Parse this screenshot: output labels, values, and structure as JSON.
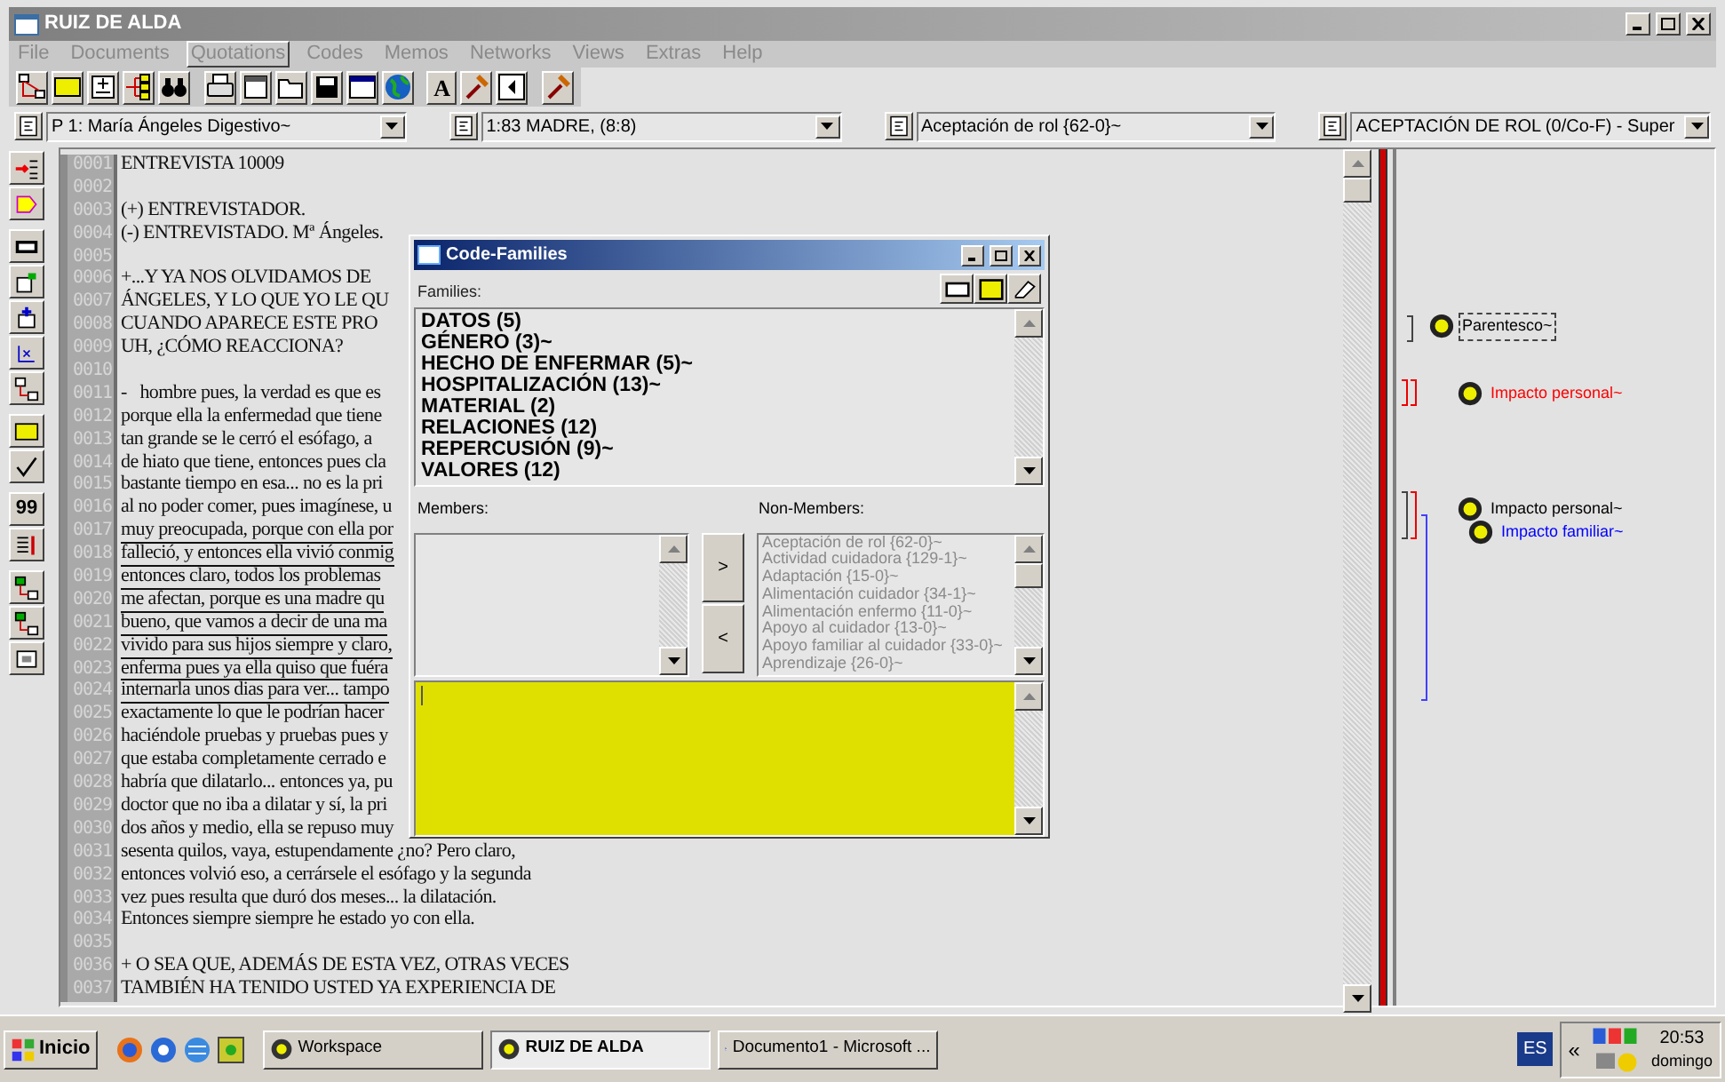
{
  "window": {
    "title": "RUIZ DE ALDA"
  },
  "menu": [
    {
      "label": "File",
      "selected": false
    },
    {
      "label": "Documents",
      "selected": false
    },
    {
      "label": "Quotations",
      "selected": true
    },
    {
      "label": "Codes",
      "selected": false
    },
    {
      "label": "Memos",
      "selected": false
    },
    {
      "label": "Networks",
      "selected": false
    },
    {
      "label": "Views",
      "selected": false
    },
    {
      "label": "Extras",
      "selected": false
    },
    {
      "label": "Help",
      "selected": false
    }
  ],
  "toolbar": {
    "letter_button": "A"
  },
  "selectors": [
    "P 1: María Ángeles Digestivo~",
    "1:83 MADRE, (8:8)",
    "Aceptación de rol {62-0}~",
    "ACEPTACIÓN DE ROL (0/Co-F) - Super"
  ],
  "side_toolbar": {
    "quote_button": "99"
  },
  "document_lines": [
    {
      "number": "0001",
      "text": "ENTREVISTA 10009",
      "underlined": false
    },
    {
      "number": "0002"
    },
    {
      "number": "0003",
      "text": "(+) ENTREVISTADOR.",
      "underlined": false
    },
    {
      "number": "0004",
      "text": "(-) ENTREVISTADO. Mª Ángeles.",
      "underlined": false
    },
    {
      "number": "0005"
    },
    {
      "number": "0006",
      "text": "+...Y YA NOS OLVIDAMOS DE",
      "underlined": false
    },
    {
      "number": "0007",
      "text": "ÁNGELES, Y LO QUE YO LE QU",
      "underlined": false
    },
    {
      "number": "0008",
      "text": "CUANDO APARECE ESTE PRO",
      "underlined": false
    },
    {
      "number": "0009",
      "text": "UH, ¿CÓMO REACCIONA?",
      "underlined": false
    },
    {
      "number": "0010"
    },
    {
      "number": "0011",
      "text": "-   hombre pues, la verdad es que es",
      "underlined": false
    },
    {
      "number": "0012",
      "text": "porque ella la enfermedad que tiene",
      "underlined": false
    },
    {
      "number": "0013",
      "text": "tan grande se le cerró el esófago, a",
      "underlined": false
    },
    {
      "number": "0014",
      "text": "de hiato que tiene, entonces pues cla",
      "underlined": false
    },
    {
      "number": "0015",
      "text": "bastante tiempo en esa... no es la pri",
      "underlined": false
    },
    {
      "number": "0016",
      "text": "al no poder comer, pues imagínese, u",
      "underlined": false
    },
    {
      "number": "0017",
      "text": "muy preocupada, porque con ella por",
      "underlined": true
    },
    {
      "number": "0018",
      "text": "falleció, y entonces ella vivió conmig",
      "underlined": true
    },
    {
      "number": "0019",
      "text": "entonces claro, todos los problemas",
      "underlined": true
    },
    {
      "number": "0020",
      "text": "me afectan, porque es una madre qu",
      "underlined": true
    },
    {
      "number": "0021",
      "text": "bueno, que vamos a decir de una ma",
      "underlined": true
    },
    {
      "number": "0022",
      "text": "vivido para sus hijos siempre y claro,",
      "underlined": true
    },
    {
      "number": "0023",
      "text": "enferma pues ya ella quiso que fuéra",
      "underlined": true
    },
    {
      "number": "0024",
      "text": "internarla unos dias para ver... tampo",
      "underlined": true
    },
    {
      "number": "0025",
      "text": "exactamente lo que le podrían hacer",
      "underlined": false
    },
    {
      "number": "0026",
      "text": "haciéndole pruebas y pruebas pues y",
      "underlined": false
    },
    {
      "number": "0027",
      "text": "que estaba completamente cerrado e",
      "underlined": false
    },
    {
      "number": "0028",
      "text": "habría que dilatarlo... entonces ya, pu",
      "underlined": false
    },
    {
      "number": "0029",
      "text": "doctor que no iba a dilatar y sí, la pri",
      "underlined": false
    },
    {
      "number": "0030",
      "text": "dos años y medio, ella se repuso muy",
      "underlined": false
    },
    {
      "number": "0031",
      "text": "sesenta quilos, vaya, estupendamente ¿no? Pero claro,",
      "underlined": false
    },
    {
      "number": "0032",
      "text": "entonces volvió eso, a cerrársele el esófago y la segunda",
      "underlined": false
    },
    {
      "number": "0033",
      "text": "vez pues resulta que duró dos meses... la dilatación.",
      "underlined": false
    },
    {
      "number": "0034",
      "text": "Entonces siempre siempre he estado yo con ella.",
      "underlined": false
    },
    {
      "number": "0035"
    },
    {
      "number": "0036",
      "text": "+ O SEA QUE, ADEMÁS DE ESTA VEZ, OTRAS VECES",
      "underlined": false
    },
    {
      "number": "0037",
      "text": "TAMBIÉN HA TENIDO USTED YA EXPERIENCIA DE",
      "underlined": false
    }
  ],
  "margin_codes": [
    {
      "label": "Parentesco~",
      "color": "#000000",
      "selected": true
    },
    {
      "label": "Impacto personal~",
      "color": "#ff0000",
      "selected": false
    },
    {
      "label": "Impacto personal~",
      "color": "#000000",
      "selected": false
    },
    {
      "label": "Impacto familiar~",
      "color": "#0000ff",
      "selected": false
    }
  ],
  "dialog": {
    "title": "Code-Families",
    "families_label": "Families:",
    "families": [
      "DATOS (5)",
      "GÉNERO (3)~",
      "HECHO DE ENFERMAR (5)~",
      "HOSPITALIZACIÓN (13)~",
      "MATERIAL (2)",
      "RELACIONES (12)",
      "REPERCUSIÓN (9)~",
      "VALORES (12)"
    ],
    "members_label": "Members:",
    "non_members_label": "Non-Members:",
    "add_button": ">",
    "remove_button": "<",
    "non_members": [
      "Aceptación de rol {62-0}~",
      "Actividad cuidadora {129-1}~",
      "Adaptación {15-0}~",
      "Alimentación cuidador {34-1}~",
      "Alimentación enfermo {11-0}~",
      "Apoyo al cuidador {13-0}~",
      "Apoyo familiar al cuidador {33-0}~",
      "Aprendizaje {26-0}~"
    ]
  },
  "taskbar": {
    "start": "Inicio",
    "tasks": [
      {
        "label": "Workspace",
        "selected": false
      },
      {
        "label": "RUIZ DE ALDA",
        "selected": true
      },
      {
        "label": "Documento1 - Microsoft ...",
        "selected": false
      }
    ],
    "language": "ES",
    "tray_toggle": "«",
    "time": "20:53",
    "day": "domingo"
  }
}
